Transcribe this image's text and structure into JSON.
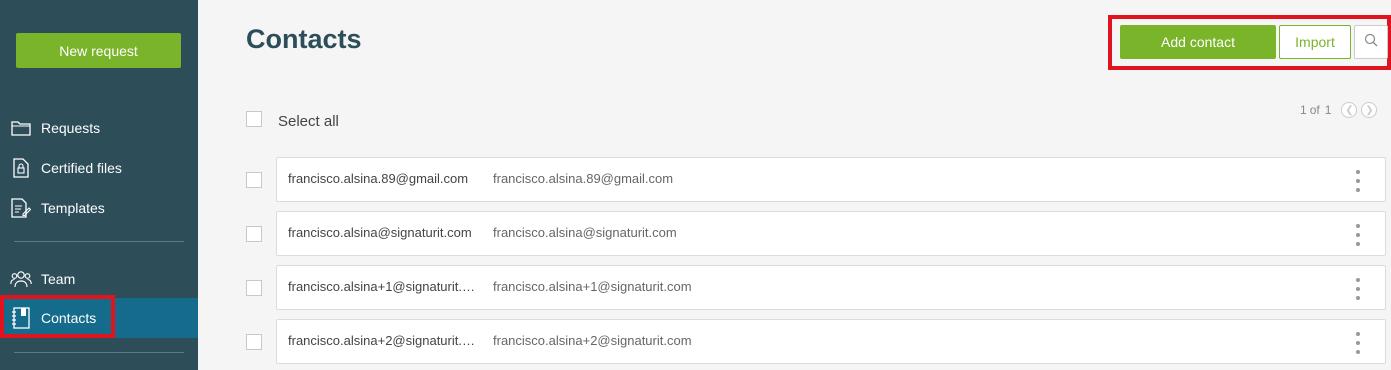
{
  "sidebar": {
    "new_request_label": "New request",
    "items": [
      {
        "label": "Requests",
        "icon": "folder-icon"
      },
      {
        "label": "Certified files",
        "icon": "certified-file-icon"
      },
      {
        "label": "Templates",
        "icon": "template-icon"
      },
      {
        "label": "Team",
        "icon": "team-icon"
      },
      {
        "label": "Contacts",
        "icon": "contacts-book-icon",
        "active": true
      }
    ]
  },
  "header": {
    "title": "Contacts",
    "add_contact_label": "Add contact",
    "import_label": "Import",
    "search_icon": "search-icon"
  },
  "list": {
    "select_all_label": "Select all",
    "pagination": {
      "current": "1",
      "of_label": "of",
      "total": "1"
    },
    "contacts": [
      {
        "name": "francisco.alsina.89@gmail.com",
        "email": "francisco.alsina.89@gmail.com"
      },
      {
        "name": "francisco.alsina@signaturit.com",
        "email": "francisco.alsina@signaturit.com"
      },
      {
        "name": "francisco.alsina+1@signaturit.com",
        "email": "francisco.alsina+1@signaturit.com"
      },
      {
        "name": "francisco.alsina+2@signaturit.com",
        "email": "francisco.alsina+2@signaturit.com"
      }
    ]
  },
  "colors": {
    "sidebar_bg": "#2d4d59",
    "active_bg": "#146b8c",
    "accent_green": "#7ab42a",
    "highlight_red": "#e0141e"
  }
}
